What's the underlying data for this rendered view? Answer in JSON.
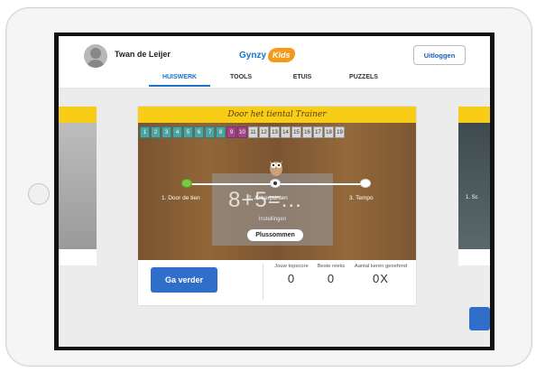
{
  "header": {
    "user_name": "Twan de Leijer",
    "logo_text": "Gynzy",
    "logo_badge": "Kids",
    "logout_label": "Uitloggen",
    "tabs": [
      {
        "label": "HUISWERK",
        "active": true
      },
      {
        "label": "TOOLS",
        "active": false
      },
      {
        "label": "ETUIS",
        "active": false
      },
      {
        "label": "PUZZELS",
        "active": false
      }
    ]
  },
  "card": {
    "title": "Door het tiental Trainer",
    "numbers": [
      "1",
      "2",
      "3",
      "4",
      "5",
      "6",
      "7",
      "8",
      "9",
      "10",
      "11",
      "12",
      "13",
      "14",
      "15",
      "16",
      "17",
      "18",
      "19"
    ],
    "sum_text": "8+5=...",
    "steps": [
      {
        "label": "1. Door de tien"
      },
      {
        "label": "2. Ankerpunten"
      },
      {
        "label": "3. Tempo"
      }
    ],
    "settings_label": "Instellingen",
    "mode_label": "Plussommen",
    "go_button": "Ga verder",
    "stats": [
      {
        "label": "Jouw topscore",
        "value": "0"
      },
      {
        "label": "Beste reeks",
        "value": "0"
      },
      {
        "label": "Aantal keren geoefend",
        "value": "0X"
      }
    ]
  },
  "side_right_label": "1. Sc",
  "pager": {
    "count": 6,
    "active_index": 3
  },
  "colors": {
    "accent": "#1a73c8",
    "button": "#2f6fc9",
    "title_bar": "#f7cd18",
    "logo_badge": "#f39a1b"
  }
}
